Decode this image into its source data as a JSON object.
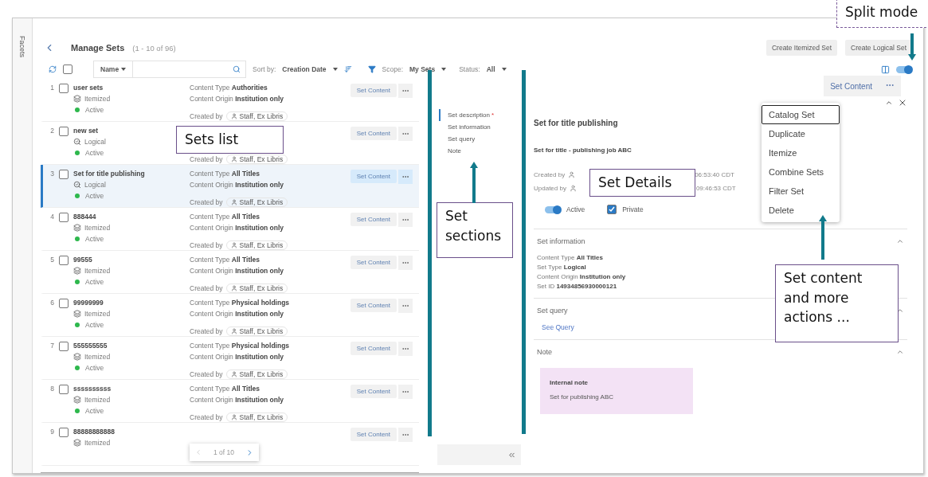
{
  "sidebar_tab": "Facets",
  "header": {
    "title": "Manage Sets",
    "count": "(1 - 10 of 96)",
    "buttons": [
      "Create Itemized Set",
      "Create Logical Set"
    ]
  },
  "toolbar": {
    "select_all_checked": false,
    "field": "Name",
    "sort_label": "Sort by:",
    "sort_value": "Creation Date",
    "scope_label": "Scope:",
    "scope_value": "My Sets",
    "status_label": "Status:",
    "status_value": "All",
    "split_mode_on": true
  },
  "sets": [
    {
      "number": "1",
      "checked": false,
      "selected": false,
      "name": "user sets",
      "kind": "itemized",
      "type": "Itemized",
      "status": "Active",
      "details": [
        {
          "label": "Content Type",
          "value": "Authorities"
        },
        {
          "label": "Content Origin",
          "value": "Institution only"
        }
      ],
      "created_label": "Created by",
      "created_by": "Staff, Ex Libris",
      "button": "Set Content"
    },
    {
      "number": "2",
      "checked": false,
      "selected": false,
      "name": "new set",
      "kind": "logical",
      "type": "Logical",
      "status": "Active",
      "created_label": "Created by",
      "created_by": "Staff, Ex Libris",
      "button": "Set Content"
    },
    {
      "number": "3",
      "checked": false,
      "selected": true,
      "name": "Set for title publishing",
      "kind": "logical",
      "type": "Logical",
      "status": "Active",
      "details": [
        {
          "label": "Content Type",
          "value": "All Titles"
        },
        {
          "label": "Content Origin",
          "value": "Institution only"
        }
      ],
      "created_label": "Created by",
      "created_by": "Staff, Ex Libris",
      "button": "Set Content"
    },
    {
      "number": "4",
      "checked": false,
      "selected": false,
      "name": "888444",
      "kind": "itemized",
      "type": "Itemized",
      "status": "Active",
      "details": [
        {
          "label": "Content Type",
          "value": "All Titles"
        },
        {
          "label": "Content Origin",
          "value": "Institution only"
        }
      ],
      "created_label": "Created by",
      "created_by": "Staff, Ex Libris",
      "button": "Set Content"
    },
    {
      "number": "5",
      "checked": false,
      "selected": false,
      "name": "99555",
      "kind": "itemized",
      "type": "Itemized",
      "status": "Active",
      "details": [
        {
          "label": "Content Type",
          "value": "All Titles"
        },
        {
          "label": "Content Origin",
          "value": "Institution only"
        }
      ],
      "created_label": "Created by",
      "created_by": "Staff, Ex Libris",
      "button": "Set Content"
    },
    {
      "number": "6",
      "checked": false,
      "selected": false,
      "name": "99999999",
      "kind": "itemized",
      "type": "Itemized",
      "status": "Active",
      "details": [
        {
          "label": "Content Type",
          "value": "Physical holdings"
        },
        {
          "label": "Content Origin",
          "value": "Institution only"
        }
      ],
      "created_label": "Created by",
      "created_by": "Staff, Ex Libris",
      "button": "Set Content"
    },
    {
      "number": "7",
      "checked": false,
      "selected": false,
      "name": "555555555",
      "kind": "itemized",
      "type": "Itemized",
      "status": "Active",
      "details": [
        {
          "label": "Content Type",
          "value": "Physical holdings"
        },
        {
          "label": "Content Origin",
          "value": "Institution only"
        }
      ],
      "created_label": "Created by",
      "created_by": "Staff, Ex Libris",
      "button": "Set Content"
    },
    {
      "number": "8",
      "checked": false,
      "selected": false,
      "name": "ssssssssss",
      "kind": "itemized",
      "type": "Itemized",
      "status": "Active",
      "details": [
        {
          "label": "Content Type",
          "value": "All Titles"
        },
        {
          "label": "Content Origin",
          "value": "Institution only"
        }
      ],
      "created_label": "Created by",
      "created_by": "Staff, Ex Libris",
      "button": "Set Content"
    },
    {
      "number": "9",
      "checked": false,
      "selected": false,
      "name": "88888888888",
      "kind": "itemized",
      "type": "Itemized",
      "button": "Set Content"
    }
  ],
  "pagination": {
    "text": "1 of 10"
  },
  "sections_nav": [
    {
      "label": "Set description",
      "mark": "*",
      "selected": true
    },
    {
      "label": "Set information",
      "selected": false
    },
    {
      "label": "Set query",
      "selected": false
    },
    {
      "label": "Note",
      "selected": false
    }
  ],
  "details": {
    "title": "Set for title publishing",
    "subtitle": "Set for title -  publishing job ABC",
    "audit": [
      {
        "label": "Created by",
        "time": "06:53:40 CDT"
      },
      {
        "label": "Updated by",
        "time": "09:46:53 CDT"
      }
    ],
    "active": {
      "label": "Active",
      "on": true
    },
    "private": {
      "label": "Private",
      "checked": true
    },
    "sections": [
      {
        "kind": "info",
        "title": "Set information",
        "expanded": true,
        "lines": [
          {
            "label": "Content Type",
            "value": "All Titles"
          },
          {
            "label": "Set Type",
            "value": "Logical"
          },
          {
            "label": "Content Origin",
            "value": "Institution only"
          },
          {
            "label": "Set ID",
            "value": "14934856930000121"
          }
        ]
      },
      {
        "kind": "link",
        "title": "Set query",
        "expanded": true,
        "link": "See Query"
      },
      {
        "kind": "note",
        "title": "Note",
        "expanded": true,
        "note_title": "Internal note",
        "note_text": "Set for publishing ABC"
      }
    ]
  },
  "actions": {
    "button": "Set Content",
    "menu": [
      {
        "label": "Catalog Set",
        "focused": true
      },
      {
        "label": "Duplicate",
        "focused": false
      },
      {
        "label": "Itemize",
        "focused": false
      },
      {
        "label": "Combine Sets",
        "focused": false
      },
      {
        "label": "Filter Set",
        "focused": false
      },
      {
        "label": "Delete",
        "focused": false
      }
    ]
  },
  "annotations": [
    {
      "text": "Split mode"
    },
    {
      "text": "Sets list"
    },
    {
      "text": "Set sections"
    },
    {
      "text": "Set Details"
    },
    {
      "text": "Set content and more actions ..."
    }
  ]
}
